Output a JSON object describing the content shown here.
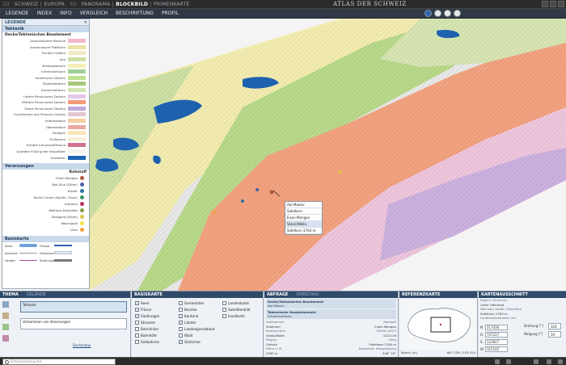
{
  "topbar": {
    "tabs": [
      {
        "label": "2D",
        "state": "dim"
      },
      {
        "label": "SCHWEIZ",
        "state": "normal"
      },
      {
        "label": "EUROPA",
        "state": "normal"
      },
      {
        "label": "3D",
        "state": "dim"
      },
      {
        "label": "PANORAMA",
        "state": "normal"
      },
      {
        "label": "BLOCKBILD",
        "state": "active"
      },
      {
        "label": "PRIMENKARTE",
        "state": "normal"
      }
    ],
    "brand": "ATLAS DER SCHWEIZ"
  },
  "menubar": {
    "items": [
      "LEGENDE",
      "INDEX",
      "INFO",
      "VERGLEICH",
      "BESCHRIFTUNG",
      "PROFIL"
    ]
  },
  "legend": {
    "title": "LEGENDE",
    "tektonik": {
      "header": "Tektonik",
      "subheader": "Decke/Tektonisches Bauelement",
      "items": [
        {
          "label": "Aussenalpines Massive",
          "color": "#f2b9c9"
        },
        {
          "label": "Aussenalpine Plattform",
          "color": "#e9e3a8"
        },
        {
          "label": "Tertiäre Gräben",
          "color": "#f3e9c4"
        },
        {
          "label": "Jura",
          "color": "#cde0a4"
        },
        {
          "label": "Molassebecken",
          "color": "#f4efb7"
        },
        {
          "label": "Infrahelvetikum",
          "color": "#9fcf98"
        },
        {
          "label": "Helvetische Decken",
          "color": "#bfe08f"
        },
        {
          "label": "Südhelvetikum",
          "color": "#a7c77a"
        },
        {
          "label": "Ultrahelvetikum",
          "color": "#d4e4b4"
        },
        {
          "label": "Untere Penninische Decken",
          "color": "#e6c6ea"
        },
        {
          "label": "Mittlere Penninische Decken",
          "color": "#f29b77"
        },
        {
          "label": "Obere Penninische Decken",
          "color": "#c3a9db"
        },
        {
          "label": "Flyschserien des Piemont-Ozeans",
          "color": "#e3c6cf"
        },
        {
          "label": "Unterostalpin",
          "color": "#f5cfa3"
        },
        {
          "label": "Oberostalpin",
          "color": "#e9a9a0"
        },
        {
          "label": "Südalpin",
          "color": "#fbe6b8"
        },
        {
          "label": "Po-Becken",
          "color": "#f6f1d6"
        },
        {
          "label": "Tertiäre Intrusiva/Effusiva",
          "color": "#d2748f"
        },
        {
          "label": "Quartäre Füllung der Haupttäler",
          "color": "#f7f5ec"
        },
        {
          "label": "Gewässer",
          "color": "#1e63b1"
        }
      ]
    },
    "vererzungen": {
      "header": "Vererzungen",
      "subheader": "Rohstoff",
      "items": [
        {
          "label": "Eisen-Mangan",
          "color": "#b05a3c"
        },
        {
          "label": "Blei-Zink (Silber)",
          "color": "#4a5ea8"
        },
        {
          "label": "Kupfer",
          "color": "#2f6fa6"
        },
        {
          "label": "Nickel-Chrom (Kupfer, Eisen)",
          "color": "#3b8f6e"
        },
        {
          "label": "Antimon",
          "color": "#c0305a"
        },
        {
          "label": "Wolfram-Molybdän",
          "color": "#8a9a4a"
        },
        {
          "label": "Berggold (Silber)",
          "color": "#e2c548"
        },
        {
          "label": "Waschgold",
          "color": "#f1e34b"
        },
        {
          "label": "Uran",
          "color": "#f0a23a"
        }
      ]
    },
    "basiskarte": {
      "header": "Basiskarte",
      "rows": [
        {
          "label": "Seen",
          "label2": "Flüsse"
        },
        {
          "label": "Kantone",
          "label2": "Gletscher"
        },
        {
          "label": "Länder",
          "label2": "Siedlungen"
        }
      ]
    }
  },
  "tooltip": {
    "lines": [
      "Aar-Massiv",
      "Sidelhorn",
      "Eisen-Mangan",
      "Valais/Wallis",
      "Sidelhorn   2764 m"
    ]
  },
  "thema": {
    "tabs": [
      "THEMA",
      "GELÄNDE"
    ],
    "item1": "Tektonik",
    "item2": "Vorkommen von Vererzungen",
    "link": "Deckenbau"
  },
  "basiskarte_panel": {
    "header": "BASISKARTE",
    "col1": [
      {
        "label": "Seen",
        "checked": true
      },
      {
        "label": "Flüsse",
        "checked": true
      },
      {
        "label": "Siedlungen",
        "checked": true
      },
      {
        "label": "Strassen",
        "checked": false
      },
      {
        "label": "Bahnlinien",
        "checked": false
      },
      {
        "label": "Bahnhöfe",
        "checked": false
      },
      {
        "label": "Seilbahnen",
        "checked": false
      }
    ],
    "col2": [
      {
        "label": "Gemeinden",
        "checked": false
      },
      {
        "label": "Bezirke",
        "checked": false
      },
      {
        "label": "Kantone",
        "checked": true
      },
      {
        "label": "Länder",
        "checked": true
      },
      {
        "label": "Landesgrenzband",
        "checked": false
      },
      {
        "label": "Wald",
        "checked": false
      },
      {
        "label": "Gletscher",
        "checked": true
      }
    ],
    "col3": [
      {
        "label": "Landeskarte",
        "checked": false
      },
      {
        "label": "Satellitenbild",
        "checked": false
      },
      {
        "label": "Inselkarte",
        "checked": false
      }
    ]
  },
  "abfrage": {
    "tabs": [
      "ABFRAGE",
      "VORSCHAU"
    ],
    "block1_title": "Decke/Tektonisches Bauelement",
    "block1_value": "Aar-Massiv",
    "block2_title": "Tektonische Hauptelemente",
    "block2_value": "Infrahelvetikum",
    "rows": [
      {
        "k": "Vorkommen",
        "v": "Rohstoff"
      },
      {
        "k": "Sidelhorn",
        "v": "Eisen-Mangan"
      },
      {
        "k": "Kanton/Land",
        "v": "Fläche (km²)"
      },
      {
        "k": "Valais/Wallis",
        "v": "5224.26"
      },
      {
        "k": "Region",
        "v": "Berg"
      },
      {
        "k": "Gletsch",
        "v": "Sidelhorn   2764 m"
      },
      {
        "k": "Höhe ü. M.",
        "v": "Exposition   Hangneigung"
      },
      {
        "k": "2565 m",
        "v": "348°   29°"
      }
    ]
  },
  "referenzkarte": {
    "header": "REFERENZKARTE",
    "coords_label": "Koord. (m)",
    "coords_value": "667 139 / 153 414"
  },
  "kartenausschnitt": {
    "header": "KARTENAUSSCHNITT",
    "region_label": "Region (Zentrum)",
    "region_value": "Unter Oberland",
    "point_label": "Nächster Gipfel / Passhöhe",
    "point_value": "Sidelhorn   2764 m",
    "coords_label": "Landeskoordinaten (m)",
    "fields": [
      {
        "k": "N",
        "v": "217436"
      },
      {
        "k": "O",
        "v": "747227"
      },
      {
        "k": "S",
        "v": "123927"
      },
      {
        "k": "W",
        "v": "315102"
      }
    ],
    "drehung_label": "Drehung [°]",
    "drehung_value": "324",
    "neigung_label": "Neigung [°]",
    "neigung_value": "19"
  },
  "status": {
    "search_placeholder": "Ortsnamensuche"
  }
}
